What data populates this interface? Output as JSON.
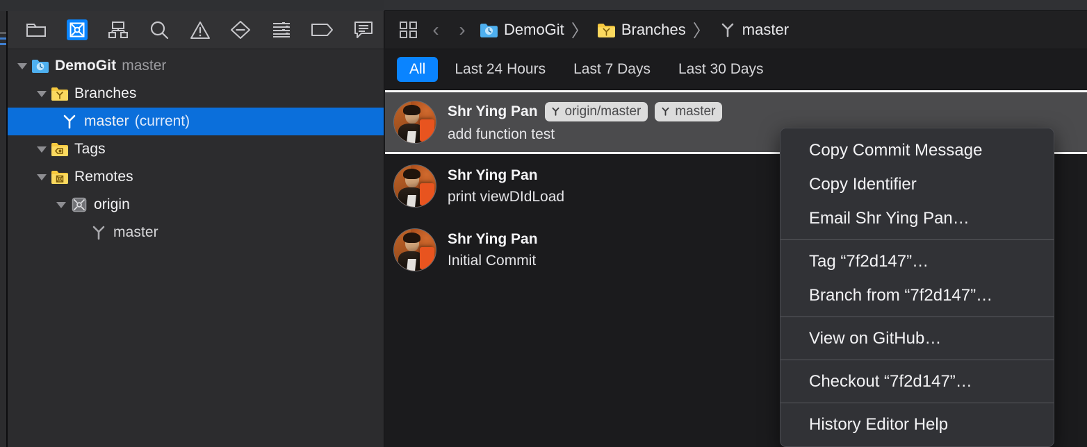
{
  "navigator": {
    "toolbar_items": [
      {
        "name": "project-navigator-icon",
        "label": "Project Navigator",
        "active": false
      },
      {
        "name": "source-control-navigator-icon",
        "label": "Source Control Navigator",
        "active": true
      },
      {
        "name": "symbol-navigator-icon",
        "label": "Symbol Navigator",
        "active": false
      },
      {
        "name": "find-navigator-icon",
        "label": "Find Navigator",
        "active": false
      },
      {
        "name": "issue-navigator-icon",
        "label": "Issue Navigator",
        "active": false
      },
      {
        "name": "test-navigator-icon",
        "label": "Test Navigator",
        "active": false
      },
      {
        "name": "debug-navigator-icon",
        "label": "Debug Navigator",
        "active": false
      },
      {
        "name": "breakpoint-navigator-icon",
        "label": "Breakpoint Navigator",
        "active": false
      },
      {
        "name": "report-navigator-icon",
        "label": "Report Navigator",
        "active": false
      }
    ],
    "tree": [
      {
        "label": "DemoGit",
        "sublabel": "master",
        "icon": "repository-icon",
        "indent": 0,
        "bold": true,
        "expanded": true,
        "selected": false
      },
      {
        "label": "Branches",
        "sublabel": "",
        "icon": "branches-folder-icon",
        "indent": 1,
        "bold": false,
        "expanded": true,
        "selected": false
      },
      {
        "label": "master",
        "sublabel": "(current)",
        "icon": "branch-icon",
        "indent": 2,
        "bold": false,
        "expanded": null,
        "selected": true
      },
      {
        "label": "Tags",
        "sublabel": "",
        "icon": "tags-folder-icon",
        "indent": 1,
        "bold": false,
        "expanded": true,
        "selected": false
      },
      {
        "label": "Remotes",
        "sublabel": "",
        "icon": "remotes-folder-icon",
        "indent": 1,
        "bold": false,
        "expanded": true,
        "selected": false
      },
      {
        "label": "origin",
        "sublabel": "",
        "icon": "remote-icon",
        "indent": 2,
        "bold": false,
        "expanded": true,
        "selected": false
      },
      {
        "label": "master",
        "sublabel": "",
        "icon": "branch-icon-dim",
        "indent": 3,
        "bold": false,
        "expanded": null,
        "selected": false
      }
    ]
  },
  "breadcrumb": {
    "back_arrow": "‹",
    "forward_arrow": "›",
    "separator": "〉",
    "items": [
      {
        "label": "DemoGit",
        "icon": "repository-icon"
      },
      {
        "label": "Branches",
        "icon": "branches-folder-icon"
      },
      {
        "label": "master",
        "icon": "branch-icon"
      }
    ]
  },
  "filters": {
    "tabs": [
      {
        "label": "All",
        "active": true
      },
      {
        "label": "Last 24 Hours",
        "active": false
      },
      {
        "label": "Last 7 Days",
        "active": false
      },
      {
        "label": "Last 30 Days",
        "active": false
      }
    ]
  },
  "commits": [
    {
      "author": "Shr Ying Pan",
      "message": "add function test",
      "selected": true,
      "badges": [
        {
          "label": "origin/master",
          "icon": "branch-icon"
        },
        {
          "label": "master",
          "icon": "branch-icon"
        }
      ]
    },
    {
      "author": "Shr Ying Pan",
      "message": "print viewDIdLoad",
      "selected": false,
      "badges": []
    },
    {
      "author": "Shr Ying Pan",
      "message": "Initial Commit",
      "selected": false,
      "badges": []
    }
  ],
  "context_menu": {
    "groups": [
      {
        "items": [
          {
            "label": "Copy Commit Message"
          },
          {
            "label": "Copy Identifier"
          },
          {
            "label": "Email Shr Ying Pan…"
          }
        ]
      },
      {
        "items": [
          {
            "label": "Tag “7f2d147”…"
          },
          {
            "label": "Branch from “7f2d147”…"
          }
        ]
      },
      {
        "items": [
          {
            "label": "View on GitHub…"
          }
        ]
      },
      {
        "items": [
          {
            "label": "Checkout “7f2d147”…"
          }
        ]
      },
      {
        "items": [
          {
            "label": "History Editor Help"
          }
        ]
      }
    ]
  },
  "colors": {
    "accent_blue": "#0a84ff",
    "selection_blue": "#0b6fdb",
    "folder_yellow": "#f5c game",
    "panel_bg": "#2c2c2e",
    "editor_bg": "#1b1b1d",
    "menu_bg": "#313236"
  }
}
